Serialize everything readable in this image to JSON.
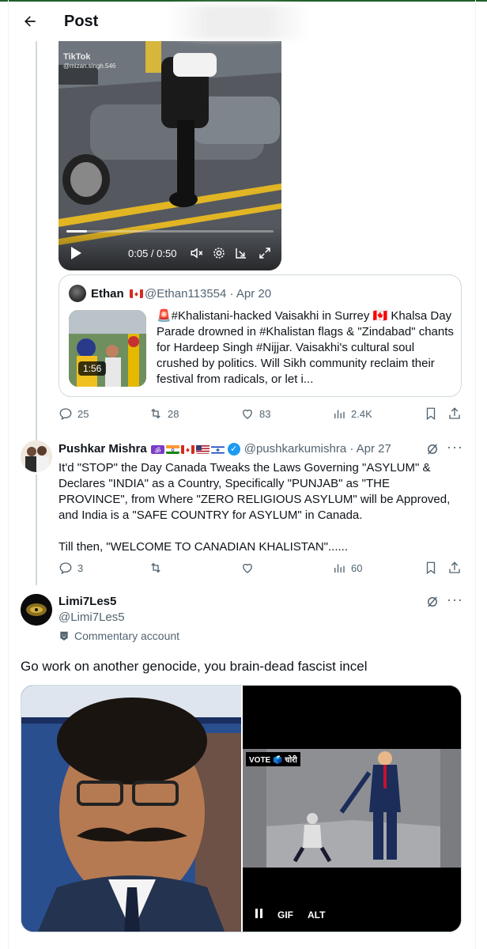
{
  "header": {
    "title": "Post"
  },
  "video": {
    "time": "0:05 / 0:50",
    "progress": 0.1,
    "watermark": "TikTok",
    "watermark_handle": "@mizan.singh.546"
  },
  "quote": {
    "name": "Ethan",
    "flag": "CA",
    "handle_date": "@Ethan113554 · Apr 20",
    "duration": "1:56",
    "text": "🚨#Khalistani-hacked Vaisakhi in Surrey 🇨🇦 Khalsa Day Parade drowned in #Khalistan flags & \"Zindabad\" chants for Hardeep Singh #Nijjar. Vaisakhi's cultural soul crushed by politics. Will Sikh community reclaim their festival from radicals, or let i..."
  },
  "post1_actions": {
    "replies": "25",
    "reposts": "28",
    "likes": "83",
    "views": "2.4K"
  },
  "reply1": {
    "name": "Pushkar Mishra",
    "handle_date": "@pushkarkumishra · Apr 27",
    "flags": [
      "om",
      "IN",
      "CA",
      "US",
      "IL"
    ],
    "text": "It'd \"STOP\" the Day Canada Tweaks the Laws Governing \"ASYLUM\" & Declares \"INDIA\" as a Country, Specifically \"PUNJAB\" as \"THE PROVINCE\", from Where \"ZERO RELIGIOUS ASYLUM\" will be Approved, and India is a \"SAFE COUNTRY for ASYLUM\" in Canada.\n\nTill then, \"WELCOME TO CANADIAN KHALISTAN\"......",
    "actions": {
      "replies": "3",
      "reposts": "",
      "likes": "",
      "views": "60"
    }
  },
  "main_post": {
    "name": "Limi7Les5",
    "handle": "@Limi7Les5",
    "commentary": "Commentary account",
    "text": "Go work on another genocide, you brain-dead fascist incel",
    "gif_controls": {
      "gif": "GIF",
      "alt": "ALT"
    },
    "vote_tag": "VOTE 🗳️ चोरी"
  },
  "colors": {
    "accent": "#1d9bf0",
    "muted": "#536471",
    "border": "#cfd9de"
  },
  "icons": [
    "back-arrow-icon",
    "play-icon",
    "mute-icon",
    "settings-icon",
    "pip-icon",
    "fullscreen-icon",
    "reply-icon",
    "repost-icon",
    "like-icon",
    "views-icon",
    "bookmark-icon",
    "share-icon",
    "grok-icon",
    "more-icon",
    "commentary-icon",
    "pause-icon"
  ]
}
